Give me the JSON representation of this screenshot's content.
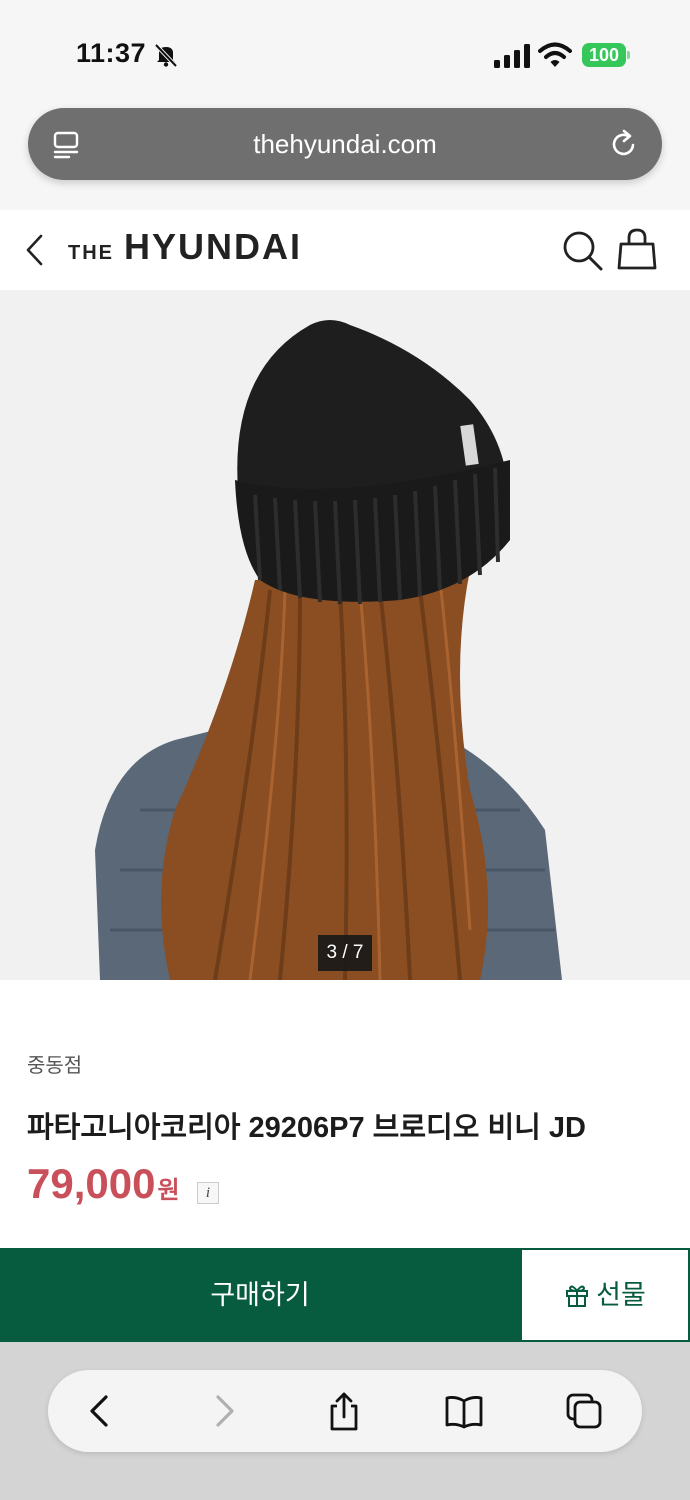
{
  "status_bar": {
    "time": "11:37",
    "battery": "100"
  },
  "browser": {
    "url": "thehyundai.com"
  },
  "header": {
    "logo_prefix": "THE",
    "logo_main": "HYUNDAI"
  },
  "gallery": {
    "counter": "3 / 7"
  },
  "product": {
    "store": "중동점",
    "title": "파타고니아코리아 29206P7 브로디오 비니 JD",
    "price": "79,000",
    "price_unit": "원",
    "info_glyph": "i"
  },
  "actions": {
    "buy_label": "구매하기",
    "gift_label": "선물"
  },
  "colors": {
    "brand_green": "#075c40",
    "price_red": "#c9505a"
  }
}
